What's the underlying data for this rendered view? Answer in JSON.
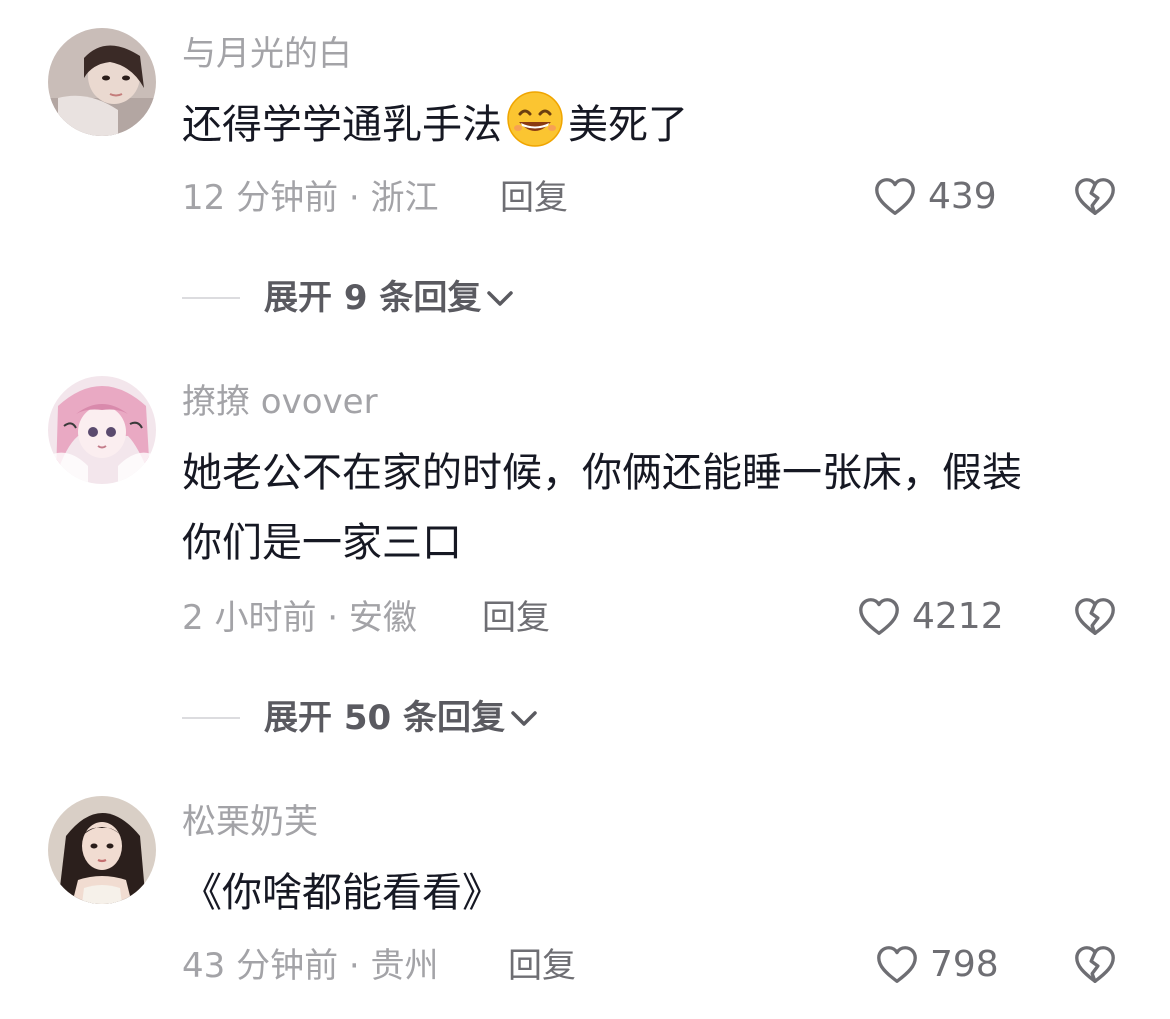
{
  "comments": [
    {
      "username": "与月光的白",
      "text_before": "还得学学通乳手法",
      "emoji": "grinning-sweat-emoji",
      "text_after": "美死了",
      "meta": "12 分钟前 · 浙江",
      "reply_label": "回复",
      "likes": "439",
      "expand_label": "展开 9 条回复"
    },
    {
      "username": "撩撩 ovover",
      "text_line1": "她老公不在家的时候，你俩还能睡一张床，假装",
      "text_line2": "你们是一家三口",
      "meta": "2 小时前 · 安徽",
      "reply_label": "回复",
      "likes": "4212",
      "expand_label": "展开 50 条回复"
    },
    {
      "username": "松栗奶芙",
      "text": "《你啥都能看看》",
      "meta": "43 分钟前 · 贵州",
      "reply_label": "回复",
      "likes": "798"
    }
  ],
  "icons": {
    "like": "heart-outline-icon",
    "dislike": "broken-heart-icon",
    "expand": "chevron-down-icon"
  },
  "colors": {
    "primary_text": "#161823",
    "secondary_text": "#a3a3a7",
    "action_text": "#6e6e73"
  }
}
